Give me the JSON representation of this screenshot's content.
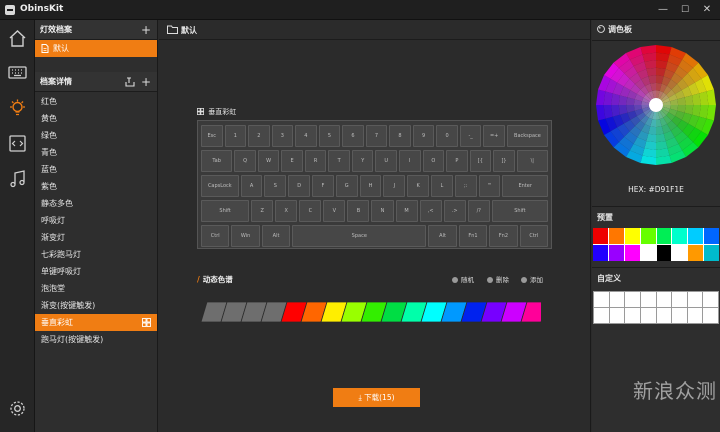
{
  "app": {
    "title": "ObinsKit"
  },
  "window": {
    "minimize": "—",
    "maximize": "☐",
    "close": "✕"
  },
  "effects": {
    "title": "灯效档案",
    "add": "+",
    "items": [
      {
        "label": "默认",
        "active": true
      }
    ]
  },
  "details": {
    "title": "档案详情",
    "add": "+",
    "items": [
      {
        "label": "红色"
      },
      {
        "label": "黄色"
      },
      {
        "label": "绿色"
      },
      {
        "label": "青色"
      },
      {
        "label": "蓝色"
      },
      {
        "label": "紫色"
      },
      {
        "label": "静态多色"
      },
      {
        "label": "呼吸灯"
      },
      {
        "label": "渐变灯"
      },
      {
        "label": "七彩跑马灯"
      },
      {
        "label": "单键呼吸灯"
      },
      {
        "label": "泡泡堂"
      },
      {
        "label": "渐变(按键触发)"
      },
      {
        "label": "垂直彩虹",
        "active": true
      },
      {
        "label": "跑马灯(按键触发)"
      }
    ]
  },
  "main": {
    "header": "默认",
    "effect_title": "垂直彩虹",
    "dynamic_label": "动态色谱",
    "random": "随机",
    "delete": "删除",
    "add": "添加",
    "download": "⤓ 下载(15)"
  },
  "keyboard": {
    "rows": [
      [
        "Esc",
        "1",
        "2",
        "3",
        "4",
        "5",
        "6",
        "7",
        "8",
        "9",
        "0",
        "-_",
        "=+",
        "Backspace"
      ],
      [
        "Tab",
        "Q",
        "W",
        "E",
        "R",
        "T",
        "Y",
        "U",
        "I",
        "O",
        "P",
        "[{",
        "]}",
        "\\|"
      ],
      [
        "CapsLock",
        "A",
        "S",
        "D",
        "F",
        "G",
        "H",
        "J",
        "K",
        "L",
        ";:",
        "'\"",
        "Enter"
      ],
      [
        "Shift",
        "Z",
        "X",
        "C",
        "V",
        "B",
        "N",
        "M",
        ",<",
        ".>",
        "/?",
        "Shift"
      ],
      [
        "Ctrl",
        "Win",
        "Alt",
        "Space",
        "Alt",
        "Fn1",
        "Fn2",
        "Ctrl"
      ]
    ]
  },
  "spectrum": {
    "colors": [
      "#6e6e6e",
      "#6e6e6e",
      "#6e6e6e",
      "#6e6e6e",
      "#ff0000",
      "#ff6600",
      "#ffee00",
      "#99ff00",
      "#33ee00",
      "#00dd44",
      "#00ffaa",
      "#00ffff",
      "#0099ff",
      "#0022ee",
      "#7700ff",
      "#cc00ff",
      "#ff0099"
    ]
  },
  "palette": {
    "title": "调色板",
    "hex_label": "HEX: #D91F1E",
    "preset_title": "预置",
    "presets": [
      "#ee0000",
      "#ff7700",
      "#ffff00",
      "#66ff00",
      "#00ee55",
      "#00ffcc",
      "#00ccff",
      "#0066ff",
      "#2200ff",
      "#9900ff",
      "#ff00ff",
      "#ffffff",
      "#000000",
      "#ffffff",
      "#ff9900",
      "#00bbcc"
    ],
    "custom_title": "自定义"
  },
  "watermark": "新浪众测"
}
